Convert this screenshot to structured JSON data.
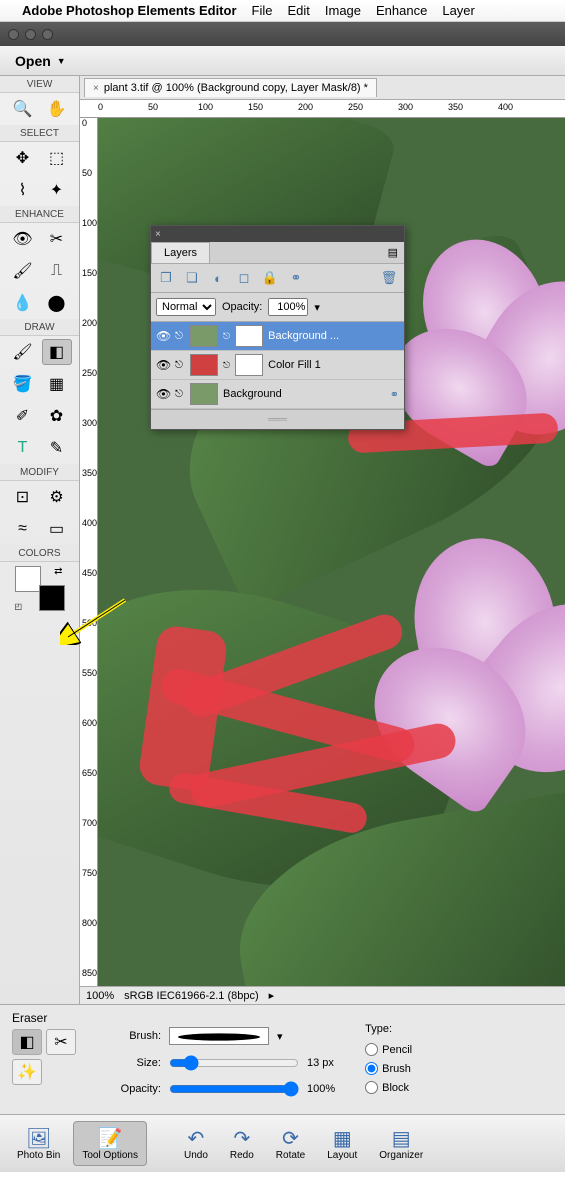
{
  "menubar": {
    "app": "Adobe Photoshop Elements Editor",
    "items": [
      "File",
      "Edit",
      "Image",
      "Enhance",
      "Layer"
    ]
  },
  "open_button": {
    "label": "Open"
  },
  "tools": {
    "sections": {
      "view": "VIEW",
      "select": "SELECT",
      "enhance": "ENHANCE",
      "draw": "DRAW",
      "modify": "MODIFY",
      "colors": "COLORS"
    }
  },
  "document": {
    "tab_title": "plant 3.tif @ 100% (Background copy, Layer Mask/8) *",
    "zoom": "100%",
    "color_profile": "sRGB IEC61966-2.1 (8bpc)",
    "ruler_h": [
      "0",
      "50",
      "100",
      "150",
      "200",
      "250",
      "300",
      "350",
      "400"
    ],
    "ruler_v": [
      "0",
      "50",
      "100",
      "150",
      "200",
      "250",
      "300",
      "350",
      "400",
      "450",
      "500",
      "550",
      "600",
      "650",
      "700",
      "750",
      "800",
      "850"
    ]
  },
  "layers_panel": {
    "title": "Layers",
    "blend_mode": "Normal",
    "opacity_label": "Opacity:",
    "opacity_value": "100%",
    "layers": [
      {
        "name": "Background ...",
        "selected": true,
        "mask": true
      },
      {
        "name": "Color Fill 1",
        "selected": false,
        "fill": true
      },
      {
        "name": "Background",
        "selected": false
      }
    ]
  },
  "options": {
    "tool": "Eraser",
    "brush_label": "Brush:",
    "size_label": "Size:",
    "size_value": "13 px",
    "opacity_label": "Opacity:",
    "opacity_value": "100%",
    "type_label": "Type:",
    "types": [
      "Pencil",
      "Brush",
      "Block"
    ],
    "type_selected": "Brush"
  },
  "bottom_bar": {
    "buttons": [
      "Photo Bin",
      "Tool Options",
      "Undo",
      "Redo",
      "Rotate",
      "Layout",
      "Organizer"
    ],
    "active": "Tool Options"
  }
}
